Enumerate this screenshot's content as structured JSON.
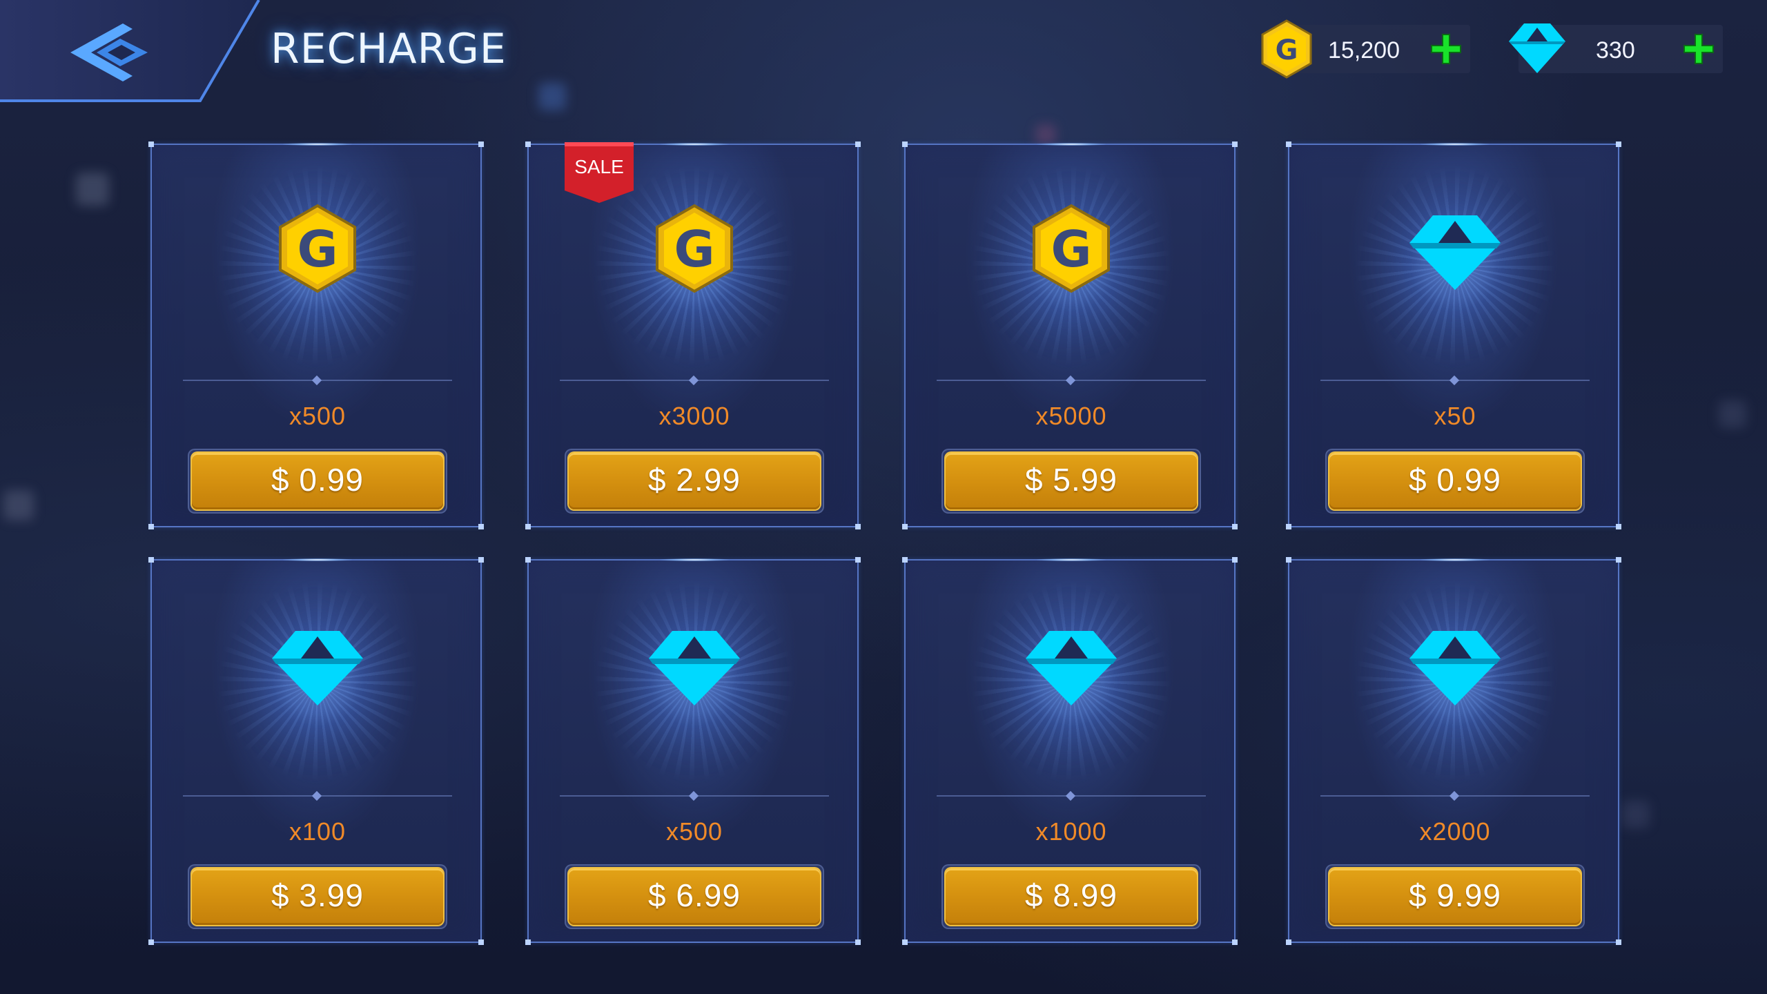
{
  "header": {
    "title": "RECHARGE",
    "back_icon": "back-arrow-icon"
  },
  "wallet": {
    "gold": {
      "icon": "gold-coin-icon",
      "value": "15,200",
      "color": "#ffcc00"
    },
    "gems": {
      "icon": "diamond-icon",
      "value": "330",
      "color": "#00d9ff"
    },
    "add_icon": "plus-icon",
    "add_color": "#19e32a"
  },
  "colors": {
    "amount_text": "#f08a28",
    "price_button": "#d69210",
    "sale_badge": "#d3202a",
    "card_border": "#5f82d7"
  },
  "products": [
    {
      "type": "gold",
      "icon": "gold-coin-icon",
      "amount": "x500",
      "price": "$ 0.99",
      "sale": false
    },
    {
      "type": "gold",
      "icon": "gold-coin-icon",
      "amount": "x3000",
      "price": "$ 2.99",
      "sale": true,
      "sale_label": "SALE"
    },
    {
      "type": "gold",
      "icon": "gold-coin-icon",
      "amount": "x5000",
      "price": "$ 5.99",
      "sale": false
    },
    {
      "type": "gem",
      "icon": "diamond-icon",
      "amount": "x50",
      "price": "$ 0.99",
      "sale": false
    },
    {
      "type": "gem",
      "icon": "diamond-icon",
      "amount": "x100",
      "price": "$ 3.99",
      "sale": false
    },
    {
      "type": "gem",
      "icon": "diamond-icon",
      "amount": "x500",
      "price": "$ 6.99",
      "sale": false
    },
    {
      "type": "gem",
      "icon": "diamond-icon",
      "amount": "x1000",
      "price": "$ 8.99",
      "sale": false
    },
    {
      "type": "gem",
      "icon": "diamond-icon",
      "amount": "x2000",
      "price": "$ 9.99",
      "sale": false
    }
  ]
}
